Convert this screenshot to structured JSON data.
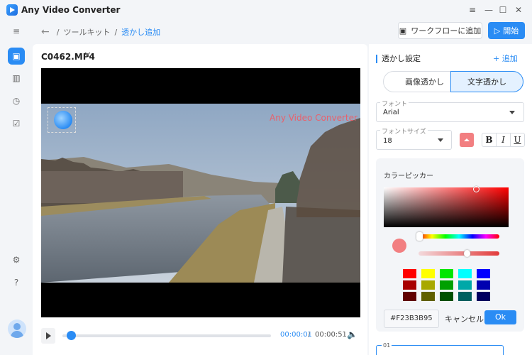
{
  "app": {
    "title": "Any Video Converter"
  },
  "window": {
    "menu_icon": "≡",
    "minimize_icon": "—",
    "maximize_icon": "☐",
    "close_icon": "✕"
  },
  "nav": {
    "items": [
      {
        "name": "collapse-icon",
        "glyph": "≡"
      },
      {
        "name": "toolkit-icon",
        "glyph": "▣"
      },
      {
        "name": "library-icon",
        "glyph": "▥"
      },
      {
        "name": "history-icon",
        "glyph": "◷"
      },
      {
        "name": "tasks-icon",
        "glyph": "☑"
      },
      {
        "name": "settings-icon",
        "glyph": "⚙"
      },
      {
        "name": "help-icon",
        "glyph": "?"
      }
    ]
  },
  "breadcrumb": {
    "back": "←",
    "sep": "/",
    "parent": "ツールキット",
    "current": "透かし追加"
  },
  "toolbar": {
    "workflow_label": "ワークフローに追加",
    "workflow_icon": "▣",
    "start_label": "開始",
    "start_icon": "▷"
  },
  "file": {
    "name": "C0462.MP4",
    "close": "✕"
  },
  "watermark": {
    "text": "Any Video Converter",
    "text_color": "#E8616C"
  },
  "player": {
    "current_time": "00:00:01",
    "separator": "/",
    "total_time": "00:00:51",
    "volume_icon": "🔈",
    "progress": 0.02
  },
  "settings": {
    "title": "透かし設定",
    "add_label": "+ 追加",
    "tab_image": "画像透かし",
    "tab_text": "文字透かし",
    "font_legend": "フォント",
    "font_value": "Arial",
    "size_legend": "フォントサイズ",
    "size_value": "18",
    "bold": "B",
    "italic": "I",
    "underline": "U"
  },
  "picker": {
    "title": "カラーピッカー",
    "hex": "#F23B3B95",
    "cancel": "キャンセル",
    "ok": "Ok",
    "accent": "#2A8CF4",
    "current_color": "#F27F81",
    "swatches": [
      "#FF0000",
      "#FFFF00",
      "#00E600",
      "#00FFFF",
      "#0000FF",
      "#A80000",
      "#A8A800",
      "#00A000",
      "#00A8A8",
      "#0000B0",
      "#600000",
      "#606000",
      "#005000",
      "#006060",
      "#000060"
    ]
  },
  "layer": {
    "label": "01"
  }
}
